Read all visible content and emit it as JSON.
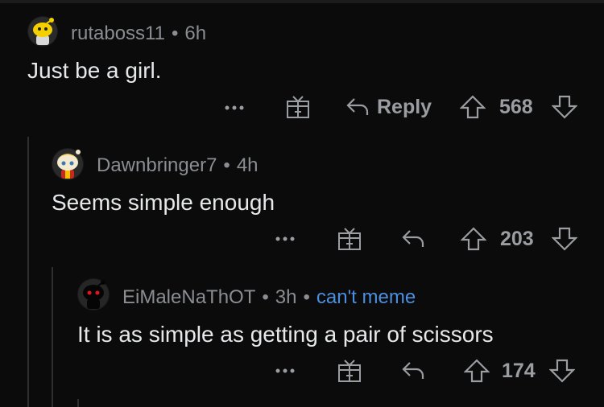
{
  "comments": [
    {
      "username": "rutaboss11",
      "time": "6h",
      "flair": "",
      "body": "Just be a girl.",
      "reply_label": "Reply",
      "votes": "568",
      "icons": {
        "more": "more-dots-icon",
        "award": "award-gift-icon",
        "reply": "reply-arrow-icon",
        "upvote": "upvote-arrow-icon",
        "downvote": "downvote-arrow-icon"
      }
    },
    {
      "username": "Dawnbringer7",
      "time": "4h",
      "flair": "",
      "body": "Seems simple enough",
      "votes": "203"
    },
    {
      "username": "EiMaleNaThOT",
      "time": "3h",
      "flair": "can't meme",
      "body": "It is as simple as getting a pair of scissors",
      "votes": "174"
    }
  ],
  "colors": {
    "background": "#0b0b0b",
    "text": "#e6e8ea",
    "meta": "#8a8d91",
    "flair": "#4a8fe0",
    "icon": "#9a9da1",
    "thread_line": "#2f2f2f"
  }
}
